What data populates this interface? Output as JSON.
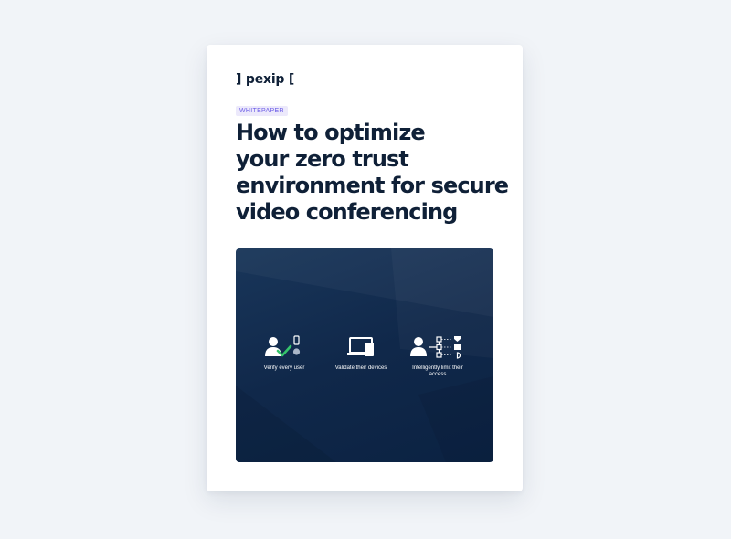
{
  "document": {
    "logo": "] pexip [",
    "badge": "WHITEPAPER",
    "title_lines": [
      "How to optimize",
      "your zero trust",
      "environment for secure",
      "video conferencing"
    ]
  },
  "features": [
    {
      "icon": "user-check-icon",
      "label": "Verify every user"
    },
    {
      "icon": "devices-icon",
      "label": "Validate their devices"
    },
    {
      "icon": "user-network-icon",
      "label": "Intelligently limit their access"
    }
  ],
  "colors": {
    "background": "#f1f4f8",
    "ink": "#0f2037",
    "badge_bg": "#ece9fb",
    "badge_text": "#6b5ce7",
    "hero_bg": "#10284a",
    "check": "#35c36b"
  }
}
